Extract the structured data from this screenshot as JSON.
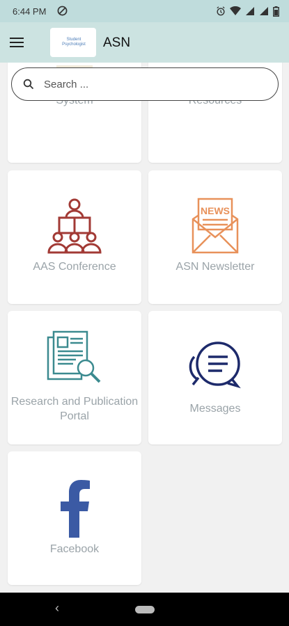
{
  "status_bar": {
    "time": "6:44 PM"
  },
  "app_bar": {
    "title": "ASN",
    "logo_text": "Student Psychologist"
  },
  "search": {
    "placeholder": "Search ..."
  },
  "tiles": [
    {
      "label": "Learning Management System",
      "icon": "lms-icon"
    },
    {
      "label": "Student and Trainee Resources",
      "icon": "resources-icon"
    },
    {
      "label": "AAS Conference",
      "icon": "conference-icon",
      "color": "#a23a35"
    },
    {
      "label": "ASN Newsletter",
      "icon": "newsletter-icon",
      "color": "#e8915a"
    },
    {
      "label": "Research and Publication Portal",
      "icon": "research-icon",
      "color": "#3b8a8f"
    },
    {
      "label": "Messages",
      "icon": "messages-icon",
      "color": "#1d2a6b"
    },
    {
      "label": "Facebook",
      "icon": "facebook-icon",
      "color": "#3b5aa4"
    }
  ]
}
